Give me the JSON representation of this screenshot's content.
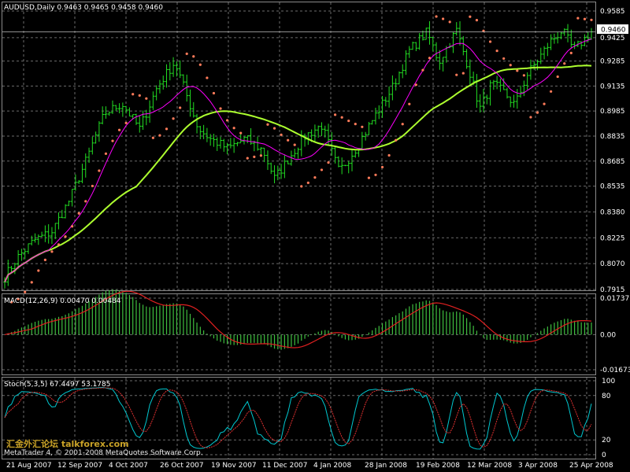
{
  "app": {
    "title_line": "AUDUSD,Daily  0.9463 0.9465 0.9458 0.9460",
    "copyright": "MetaTrader 4, © 2001-2008 MetaQuotes Software Corp.",
    "watermark": "汇金外汇论坛 talkforex.com"
  },
  "colors": {
    "background": "#000000",
    "grid": "#6b6b6b",
    "price_bars": "#22dd22",
    "sma_slow": "#adff2f",
    "sma_fast": "#ff00ff",
    "parabolic_sar": "#ff7b5a",
    "macd_hist": "#3fbf3f",
    "macd_signal": "#e02020",
    "stoch_main": "#00c8d0",
    "stoch_signal": "#e03030",
    "current_price_box": "#ffffff"
  },
  "chart_data": [
    {
      "type": "candlestick",
      "title": "AUDUSD,Daily  0.9463 0.9465 0.9458 0.9460",
      "symbol": "AUDUSD",
      "timeframe": "Daily",
      "last_ohlc": {
        "open": 0.9463,
        "high": 0.9465,
        "low": 0.9458,
        "close": 0.946
      },
      "current_price": "0.9460",
      "y_ticks": [
        "0.9585",
        "0.9425",
        "0.9285",
        "0.9135",
        "0.8985",
        "0.8835",
        "0.8685",
        "0.8535",
        "0.8380",
        "0.8225",
        "0.8070",
        "0.7915"
      ],
      "ylim": [
        0.7915,
        0.9585
      ],
      "indicators": [
        "SMA slow",
        "SMA fast",
        "Parabolic SAR"
      ],
      "grid": true,
      "close_anchors": [
        {
          "x": 0.0,
          "y": 0.799
        },
        {
          "x": 0.02,
          "y": 0.81
        },
        {
          "x": 0.05,
          "y": 0.821
        },
        {
          "x": 0.08,
          "y": 0.826
        },
        {
          "x": 0.11,
          "y": 0.845
        },
        {
          "x": 0.14,
          "y": 0.87
        },
        {
          "x": 0.17,
          "y": 0.897
        },
        {
          "x": 0.2,
          "y": 0.903
        },
        {
          "x": 0.23,
          "y": 0.888
        },
        {
          "x": 0.26,
          "y": 0.913
        },
        {
          "x": 0.29,
          "y": 0.928
        },
        {
          "x": 0.31,
          "y": 0.908
        },
        {
          "x": 0.33,
          "y": 0.888
        },
        {
          "x": 0.35,
          "y": 0.882
        },
        {
          "x": 0.38,
          "y": 0.876
        },
        {
          "x": 0.41,
          "y": 0.882
        },
        {
          "x": 0.44,
          "y": 0.875
        },
        {
          "x": 0.46,
          "y": 0.858
        },
        {
          "x": 0.48,
          "y": 0.868
        },
        {
          "x": 0.51,
          "y": 0.883
        },
        {
          "x": 0.54,
          "y": 0.89
        },
        {
          "x": 0.57,
          "y": 0.862
        },
        {
          "x": 0.6,
          "y": 0.877
        },
        {
          "x": 0.63,
          "y": 0.895
        },
        {
          "x": 0.66,
          "y": 0.912
        },
        {
          "x": 0.69,
          "y": 0.935
        },
        {
          "x": 0.72,
          "y": 0.946
        },
        {
          "x": 0.74,
          "y": 0.928
        },
        {
          "x": 0.77,
          "y": 0.947
        },
        {
          "x": 0.79,
          "y": 0.925
        },
        {
          "x": 0.81,
          "y": 0.9
        },
        {
          "x": 0.83,
          "y": 0.915
        },
        {
          "x": 0.85,
          "y": 0.91
        },
        {
          "x": 0.87,
          "y": 0.902
        },
        {
          "x": 0.89,
          "y": 0.92
        },
        {
          "x": 0.91,
          "y": 0.93
        },
        {
          "x": 0.93,
          "y": 0.94
        },
        {
          "x": 0.95,
          "y": 0.947
        },
        {
          "x": 0.97,
          "y": 0.935
        },
        {
          "x": 1.0,
          "y": 0.946
        }
      ]
    },
    {
      "type": "bar",
      "title": "MACD(12,26,9) 0.00470 0.00484",
      "y_ticks": [
        "0.01737",
        "0.00",
        "-0.01673"
      ],
      "ylim": [
        -0.01673,
        0.01737
      ],
      "grid": true
    },
    {
      "type": "line",
      "title": "Stoch(5,3,5) 67.4497 53.1785",
      "y_ticks": [
        "100",
        "80",
        "20",
        "0"
      ],
      "ylim": [
        0,
        100
      ],
      "grid": true
    }
  ],
  "x_axis_labels": [
    "21 Aug 2007",
    "12 Sep 2007",
    "4 Oct 2007",
    "26 Oct 2007",
    "19 Nov 2007",
    "11 Dec 2007",
    "4 Jan 2008",
    "28 Jan 2008",
    "19 Feb 2008",
    "12 Mar 2008",
    "3 Apr 2008",
    "25 Apr 2008"
  ]
}
